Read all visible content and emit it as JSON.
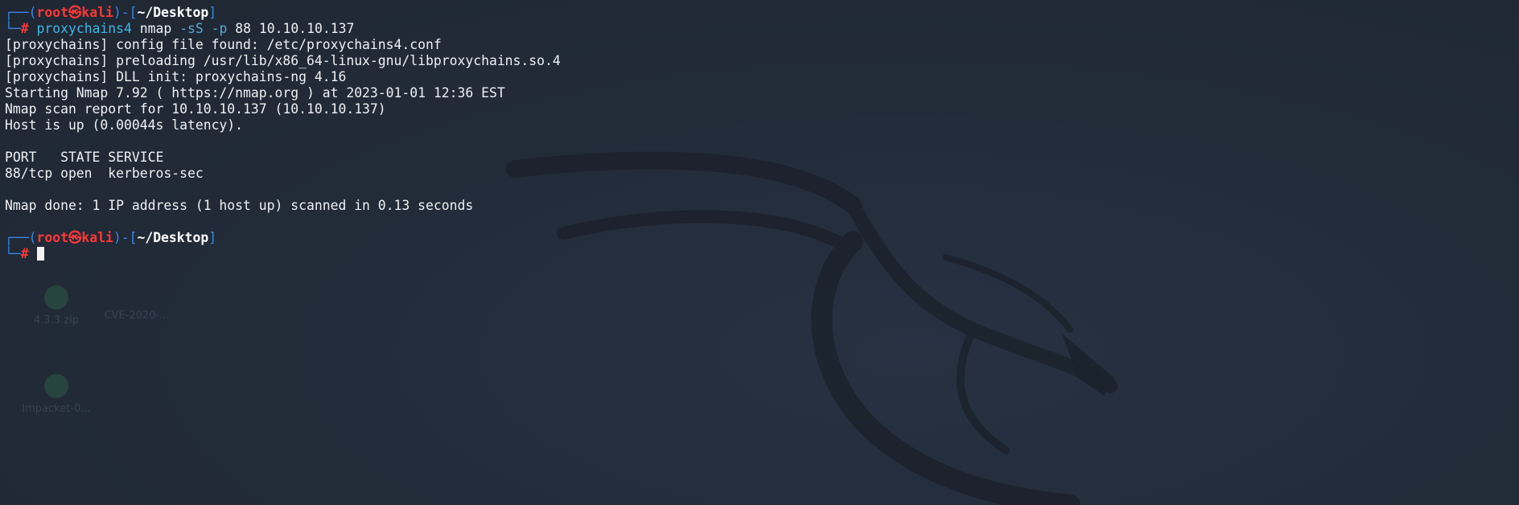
{
  "prompt": {
    "user": "root",
    "at_symbol": "㉿",
    "host": "kali",
    "path": "~/Desktop",
    "symbol": "#"
  },
  "command": {
    "program": "proxychains4",
    "arg1": "nmap",
    "flag1": "-sS",
    "flag2": "-p",
    "port": "88",
    "target": "10.10.10.137"
  },
  "output": [
    "[proxychains] config file found: /etc/proxychains4.conf",
    "[proxychains] preloading /usr/lib/x86_64-linux-gnu/libproxychains.so.4",
    "[proxychains] DLL init: proxychains-ng 4.16",
    "Starting Nmap 7.92 ( https://nmap.org ) at 2023-01-01 12:36 EST",
    "Nmap scan report for 10.10.10.137 (10.10.10.137)",
    "Host is up (0.00044s latency).",
    "",
    "PORT   STATE SERVICE",
    "88/tcp open  kerberos-sec",
    "",
    "Nmap done: 1 IP address (1 host up) scanned in 0.13 seconds",
    ""
  ],
  "desktop_icons": [
    "4.3.3.zip",
    "CVE-2020-...",
    "Impacket-0..."
  ],
  "colors": {
    "background": "#222b38",
    "prompt_frame": "#3a86e6",
    "prompt_user": "#ff3737",
    "command": "#3db8e6",
    "text": "#eef1f5"
  }
}
